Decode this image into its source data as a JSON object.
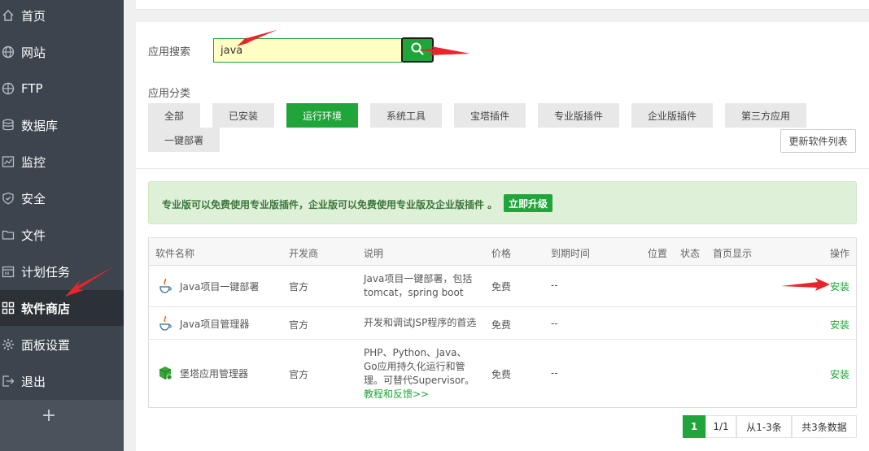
{
  "sidebar": {
    "items": [
      {
        "label": "首页",
        "icon": "home-icon"
      },
      {
        "label": "网站",
        "icon": "globe-icon"
      },
      {
        "label": "FTP",
        "icon": "ftp-icon"
      },
      {
        "label": "数据库",
        "icon": "database-icon"
      },
      {
        "label": "监控",
        "icon": "monitor-icon"
      },
      {
        "label": "安全",
        "icon": "shield-icon"
      },
      {
        "label": "文件",
        "icon": "folder-icon"
      },
      {
        "label": "计划任务",
        "icon": "calendar-icon"
      },
      {
        "label": "软件商店",
        "icon": "grid-icon",
        "active": true
      },
      {
        "label": "面板设置",
        "icon": "gear-icon"
      },
      {
        "label": "退出",
        "icon": "logout-icon"
      }
    ],
    "add_label": "+"
  },
  "search": {
    "label": "应用搜索",
    "value": "java"
  },
  "category": {
    "label": "应用分类",
    "buttons": [
      "全部",
      "已安装",
      "运行环境",
      "系统工具",
      "宝塔插件",
      "专业版插件",
      "企业版插件",
      "第三方应用",
      "一键部署"
    ],
    "active": "运行环境",
    "update_label": "更新软件列表"
  },
  "notice": {
    "text": "专业版可以免费使用专业版插件，企业版可以免费使用专业版及企业版插件 。",
    "upgrade_label": "立即升级"
  },
  "table": {
    "headers": [
      "软件名称",
      "开发商",
      "说明",
      "价格",
      "到期时间",
      "位置",
      "状态",
      "首页显示",
      "操作"
    ],
    "rows": [
      {
        "name": "Java项目一键部署",
        "developer": "官方",
        "desc_lines": [
          "Java项目一键部署，包括",
          "tomcat，spring boot"
        ],
        "price": "免费",
        "expire": "--",
        "action": "安装",
        "icon": "java-icon"
      },
      {
        "name": "Java项目管理器",
        "developer": "官方",
        "desc_lines": [
          "开发和调试JSP程序的首选"
        ],
        "price": "免费",
        "expire": "--",
        "action": "安装",
        "icon": "java-icon"
      },
      {
        "name": "堡塔应用管理器",
        "developer": "官方",
        "desc_lines": [
          "PHP、Python、Java、",
          "Go应用持久化运行和管",
          "理。可替代Supervisor。"
        ],
        "link": "教程和反馈>>",
        "price": "免费",
        "expire": "--",
        "action": "安装",
        "icon": "cube-icon"
      }
    ]
  },
  "pagination": {
    "current": "1",
    "pages": "1/1",
    "range": "从1-3条",
    "total": "共3条数据"
  },
  "colors": {
    "accent": "#20a53a",
    "sidebar": "#3c444d",
    "arrow": "#e8252b"
  }
}
